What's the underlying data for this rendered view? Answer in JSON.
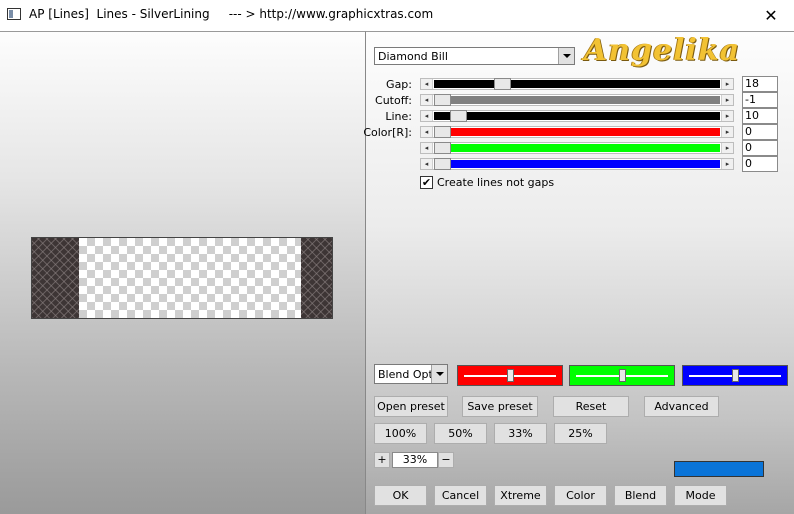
{
  "window": {
    "title": "AP [Lines]  Lines - SilverLining     --- > http://www.graphicxtras.com",
    "close_symbol": "✕"
  },
  "preset": {
    "selected": "Diamond Bill"
  },
  "logo": {
    "text": "Angelika"
  },
  "sliders": [
    {
      "label": "Gap:",
      "value": "18",
      "fraction": 0.22,
      "color": "#000000"
    },
    {
      "label": "Cutoff:",
      "value": "-1",
      "fraction": 0.0,
      "color": "#808080"
    },
    {
      "label": "Line:",
      "value": "10",
      "fraction": 0.06,
      "color": "#000000"
    },
    {
      "label": "Color[R]:",
      "value": "0",
      "fraction": 0.0,
      "color": "#ff0000"
    },
    {
      "label": "",
      "value": "0",
      "fraction": 0.0,
      "color": "#00ff00"
    },
    {
      "label": "",
      "value": "0",
      "fraction": 0.0,
      "color": "#0000ff"
    }
  ],
  "option": {
    "label": "Create lines not gaps",
    "checked": true,
    "check_glyph": "✔"
  },
  "blend": {
    "selected": "Blend Optic"
  },
  "blend_sliders": [
    {
      "color": "#ff0000",
      "level": 0.5
    },
    {
      "color": "#00ff00",
      "level": 0.5
    },
    {
      "color": "#0000ff",
      "level": 0.5
    }
  ],
  "buttons": {
    "open_preset": "Open preset",
    "save_preset": "Save preset",
    "reset": "Reset",
    "advanced": "Advanced",
    "zoom_100": "100%",
    "zoom_50": "50%",
    "zoom_33": "33%",
    "zoom_25": "25%",
    "ok": "OK",
    "cancel": "Cancel",
    "xtreme": "Xtreme",
    "color": "Color",
    "blend": "Blend",
    "mode": "Mode"
  },
  "zoom": {
    "value": "33%",
    "plus": "+",
    "minus": "−"
  },
  "swatch": {
    "color": "#0a74d8"
  },
  "glyphs": {
    "left_arrow": "◂",
    "right_arrow": "▸"
  }
}
